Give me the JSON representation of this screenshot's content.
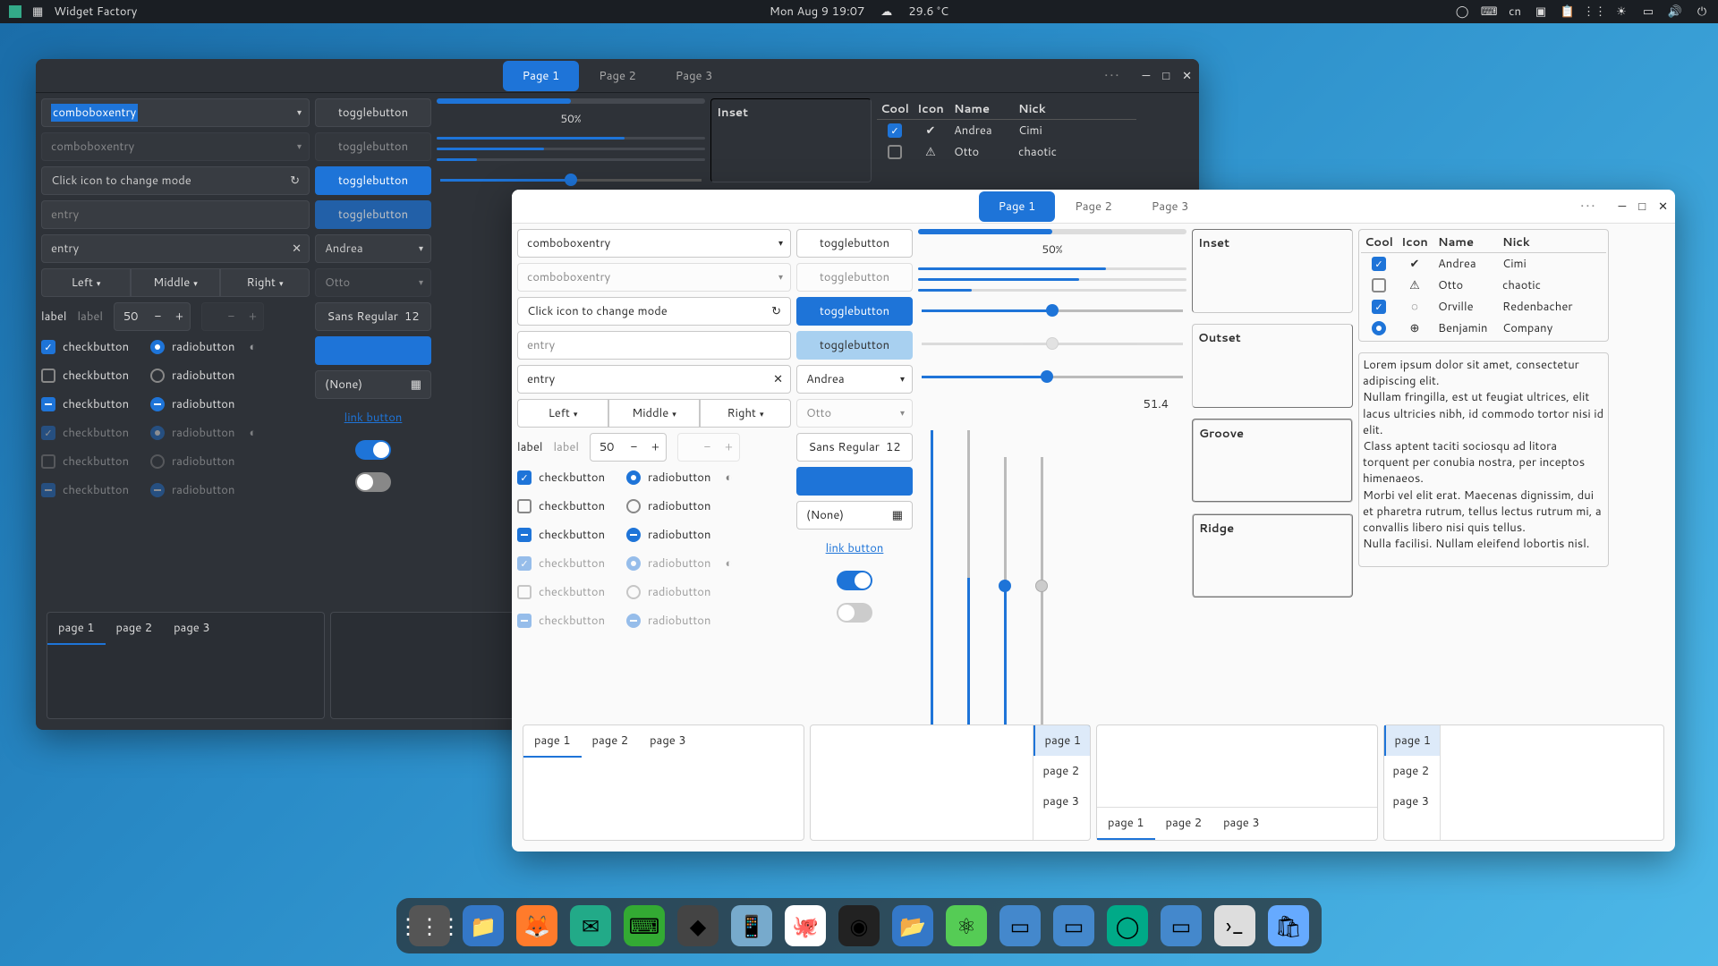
{
  "panel": {
    "app_title": "Widget Factory",
    "date_time": "Mon Aug 9  19:07",
    "temperature": "29.6 °C",
    "lang": "cn"
  },
  "dark_window": {
    "tabs": [
      "Page 1",
      "Page 2",
      "Page 3"
    ],
    "combo1": "comboboxentry",
    "combo2": "comboboxentry",
    "mode_entry": "Click icon to change mode",
    "entry_ph": "entry",
    "entry_val": "entry",
    "seg": [
      "Left",
      "Middle",
      "Right"
    ],
    "label1": "label",
    "label2": "label",
    "spin_val": "50",
    "check_label": "checkbutton",
    "radio_label": "radiobutton",
    "toggle": "togglebutton",
    "andrea": "Andrea",
    "otto": "Otto",
    "font": "Sans Regular",
    "font_size": "12",
    "none": "(None)",
    "link": "link button",
    "progress_pct": "50%",
    "inset": "Inset",
    "table_head": [
      "Cool",
      "Icon",
      "Name",
      "Nick"
    ],
    "table_rows": [
      {
        "name": "Andrea",
        "nick": "Cimi"
      },
      {
        "name": "Otto",
        "nick": "chaotic"
      }
    ],
    "bot_tabs": [
      "page 1",
      "page 2",
      "page 3"
    ]
  },
  "light_window": {
    "tabs": [
      "Page 1",
      "Page 2",
      "Page 3"
    ],
    "combo1": "comboboxentry",
    "combo2": "comboboxentry",
    "mode_entry": "Click icon to change mode",
    "entry_ph": "entry",
    "entry_val": "entry",
    "seg": [
      "Left",
      "Middle",
      "Right"
    ],
    "label1": "label",
    "label2": "label",
    "spin_val": "50",
    "check_label": "checkbutton",
    "radio_label": "radiobutton",
    "toggle": "togglebutton",
    "andrea": "Andrea",
    "otto": "Otto",
    "font": "Sans Regular",
    "font_size": "12",
    "none": "(None)",
    "link": "link button",
    "progress_pct": "50%",
    "slider_val": "51.4",
    "frames": [
      "Inset",
      "Outset",
      "Groove",
      "Ridge"
    ],
    "table_head": [
      "Cool",
      "Icon",
      "Name",
      "Nick"
    ],
    "table_rows": [
      {
        "name": "Andrea",
        "nick": "Cimi"
      },
      {
        "name": "Otto",
        "nick": "chaotic"
      },
      {
        "name": "Orville",
        "nick": "Redenbacher"
      },
      {
        "name": "Benjamin",
        "nick": "Company"
      }
    ],
    "lorem": "Lorem ipsum dolor sit amet, consectetur adipiscing elit.\nNullam fringilla, est ut feugiat ultrices, elit lacus ultricies nibh, id commodo tortor nisi id elit.\nClass aptent taciti sociosqu ad litora torquent per conubia nostra, per inceptos himenaeos.\nMorbi vel elit erat. Maecenas dignissim, dui et pharetra rutrum, tellus lectus rutrum mi, a convallis libero nisi quis tellus.\nNulla facilisi. Nullam eleifend lobortis nisl.",
    "bot_tabs": [
      "page 1",
      "page 2",
      "page 3"
    ]
  }
}
